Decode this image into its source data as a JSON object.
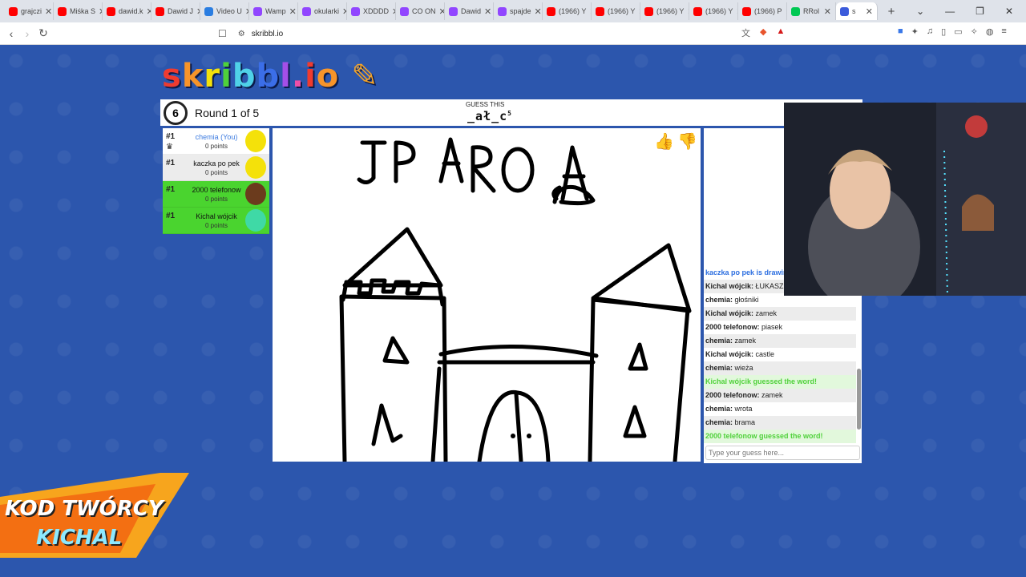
{
  "browser": {
    "tabs": [
      {
        "label": "grajczi",
        "color": "#ff0000"
      },
      {
        "label": "Miśka S",
        "color": "#ff0000"
      },
      {
        "label": "dawid.k",
        "color": "#ff0000"
      },
      {
        "label": "Dawid J",
        "color": "#ff0000"
      },
      {
        "label": "Video U",
        "color": "#2a7de1"
      },
      {
        "label": "Wamp",
        "color": "#9146ff"
      },
      {
        "label": "okularki",
        "color": "#9146ff"
      },
      {
        "label": "XDDDD",
        "color": "#9146ff"
      },
      {
        "label": "CO ON",
        "color": "#9146ff"
      },
      {
        "label": "Dawid",
        "color": "#9146ff"
      },
      {
        "label": "spajde",
        "color": "#9146ff"
      },
      {
        "label": "(1966) Y",
        "color": "#ff0000"
      },
      {
        "label": "(1966) Y",
        "color": "#ff0000"
      },
      {
        "label": "(1966) Y",
        "color": "#ff0000"
      },
      {
        "label": "(1966) Y",
        "color": "#ff0000"
      },
      {
        "label": "(1966) P",
        "color": "#ff0000"
      },
      {
        "label": "RRol",
        "color": "#00c853"
      }
    ],
    "active_tab_label": "s",
    "url": "skribbl.io"
  },
  "game": {
    "logo": "skribbl.io",
    "timer": "6",
    "round": "Round 1 of 5",
    "guess_title": "GUESS THIS",
    "word_hint": "_ał_c",
    "word_length": "5"
  },
  "players": [
    {
      "rank": "#1",
      "name": "chemia (You)",
      "points": "0 points",
      "bg": "#ffffff",
      "name_color": "#3c7be0",
      "avatar": "#f4e10a"
    },
    {
      "rank": "#1",
      "name": "kaczka po pek",
      "points": "0 points",
      "bg": "#ececec",
      "name_color": "#111111",
      "avatar": "#f4e10a"
    },
    {
      "rank": "#1",
      "name": "2000 telefonow",
      "points": "0 points",
      "bg": "#4ad42f",
      "name_color": "#111111",
      "avatar": "#6b3b1d"
    },
    {
      "rank": "#1",
      "name": "Kichal wójcik",
      "points": "0 points",
      "bg": "#4ad42f",
      "name_color": "#111111",
      "avatar": "#3fd9a6"
    }
  ],
  "chat": {
    "messages": [
      {
        "author": "",
        "text": "kaczka po pek is drawing now!",
        "kind": "sys"
      },
      {
        "author": "Kichal wójcik:",
        "text": "ŁUKASZ",
        "kind": "alt"
      },
      {
        "author": "chemia:",
        "text": "głośniki",
        "kind": "plain"
      },
      {
        "author": "Kichal wójcik:",
        "text": "zamek",
        "kind": "alt"
      },
      {
        "author": "2000 telefonow:",
        "text": "piasek",
        "kind": "plain"
      },
      {
        "author": "chemia:",
        "text": "zamek",
        "kind": "alt"
      },
      {
        "author": "Kichal wójcik:",
        "text": "castle",
        "kind": "plain"
      },
      {
        "author": "chemia:",
        "text": "wieża",
        "kind": "alt"
      },
      {
        "author": "",
        "text": "Kichal wójcik guessed the word!",
        "kind": "green"
      },
      {
        "author": "2000 telefonow:",
        "text": "zamek",
        "kind": "alt"
      },
      {
        "author": "chemia:",
        "text": "wrota",
        "kind": "plain"
      },
      {
        "author": "chemia:",
        "text": "brama",
        "kind": "alt"
      },
      {
        "author": "",
        "text": "2000 telefonow guessed the word!",
        "kind": "green"
      }
    ],
    "input_placeholder": "Type your guess here..."
  },
  "drawing": {
    "caption": "JP ARO A"
  },
  "overlay": {
    "line1": "KOD TWÓRCY",
    "line2": "KICHAL"
  }
}
